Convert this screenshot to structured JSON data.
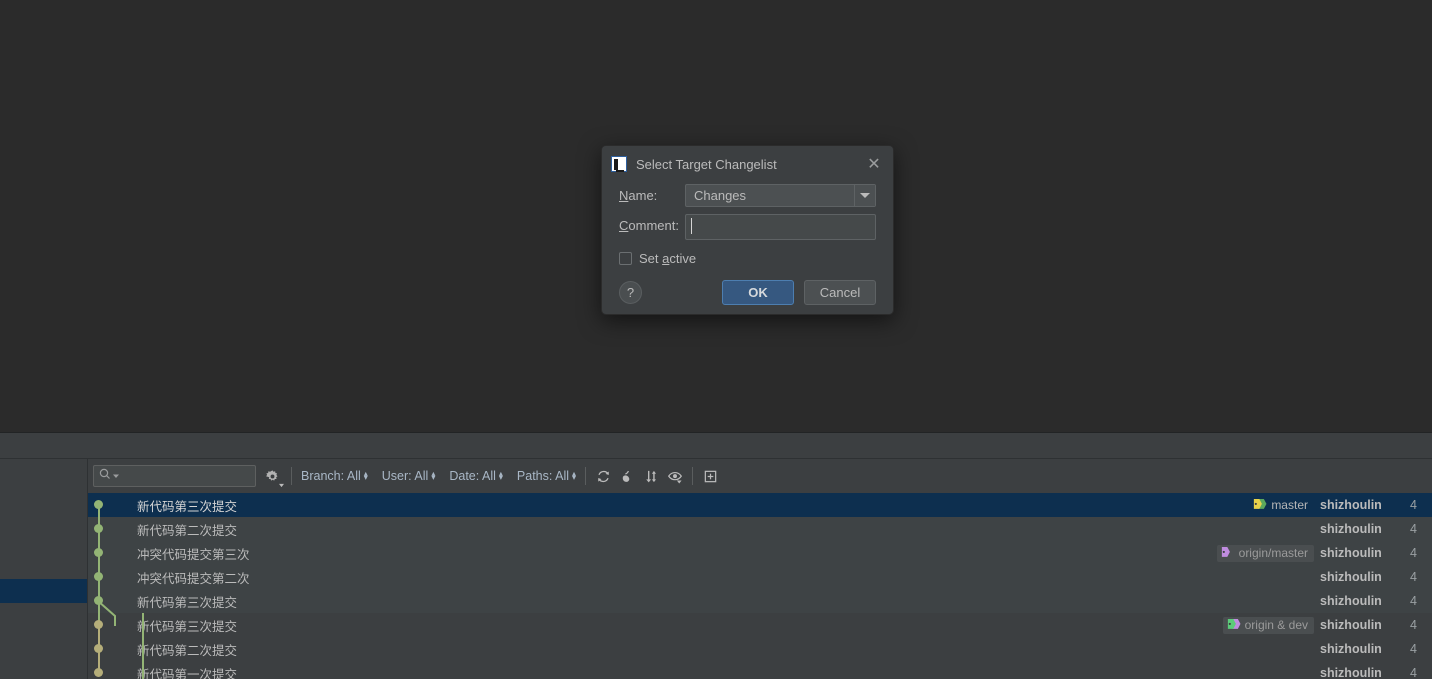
{
  "window": {
    "background": "#2b2b2b",
    "panel_background": "#3c3f41"
  },
  "dialog": {
    "title": "Select Target Changelist",
    "app_icon": "intellij-idea-logo-icon",
    "close_icon": "✕",
    "name_label": "Name:",
    "name_label_mnemonic": "N",
    "name_value": "Changes",
    "name_dropdown_icon": "chevron-down-icon",
    "comment_label": "Comment:",
    "comment_label_mnemonic": "C",
    "comment_value": "",
    "comment_placeholder": "",
    "set_active_label_pre": "Set ",
    "set_active_mnemonic": "a",
    "set_active_label_post": "ctive",
    "set_active_checked": false,
    "help_label": "?",
    "ok_label": "OK",
    "cancel_label": "Cancel",
    "ok_color": "#365880"
  },
  "log_toolbar": {
    "search_placeholder": "",
    "search_value": "",
    "search_icon": "search-icon",
    "search_dropdown_icon": "chevron-down-icon",
    "settings_icon": "gear-icon",
    "filters": [
      {
        "label": "Branch: All",
        "name": "branch-filter"
      },
      {
        "label": "User: All",
        "name": "user-filter"
      },
      {
        "label": "Date: All",
        "name": "date-filter"
      },
      {
        "label": "Paths: All",
        "name": "paths-filter"
      }
    ],
    "actions": [
      {
        "icon": "refresh-icon",
        "name": "refresh-button"
      },
      {
        "icon": "cherry-pick-icon",
        "name": "cherry-pick-button"
      },
      {
        "icon": "sort-icon",
        "name": "intellisort-button"
      },
      {
        "icon": "eye-icon",
        "name": "show-details-button"
      },
      {
        "icon": "open-in-new-tab-icon",
        "name": "open-new-tab-button"
      }
    ]
  },
  "commits": [
    {
      "subject": "新代码第三次提交",
      "author": "shizhoulin",
      "date": "4",
      "selected": true,
      "stripe": false,
      "node_color": "#93b475",
      "refs": [
        {
          "label": "master",
          "chip": false,
          "tag_colors": [
            "#e8d24a",
            "#5ca85c"
          ]
        }
      ]
    },
    {
      "subject": "新代码第二次提交",
      "author": "shizhoulin",
      "date": "4",
      "selected": false,
      "stripe": true,
      "node_color": "#93b475",
      "refs": []
    },
    {
      "subject": "冲突代码提交第三次",
      "author": "shizhoulin",
      "date": "4",
      "selected": false,
      "stripe": true,
      "node_color": "#93b475",
      "refs": [
        {
          "label": "origin/master",
          "chip": true,
          "tag_colors": [
            "#c08ce0"
          ]
        }
      ]
    },
    {
      "subject": "冲突代码提交第二次",
      "author": "shizhoulin",
      "date": "4",
      "selected": false,
      "stripe": true,
      "node_color": "#93b475",
      "refs": []
    },
    {
      "subject": "新代码第三次提交",
      "author": "shizhoulin",
      "date": "4",
      "selected": false,
      "stripe": true,
      "node_color": "#93b475",
      "refs": []
    },
    {
      "subject": "新代码第三次提交",
      "author": "shizhoulin",
      "date": "4",
      "selected": false,
      "stripe": false,
      "node_color": "#b5ae7a",
      "refs": [
        {
          "label": "origin & dev",
          "chip": true,
          "tag_colors": [
            "#5ccc7a",
            "#c08ce0"
          ]
        }
      ]
    },
    {
      "subject": "新代码第二次提交",
      "author": "shizhoulin",
      "date": "4",
      "selected": false,
      "stripe": false,
      "node_color": "#b5ae7a",
      "refs": []
    },
    {
      "subject": "新代码第一次提交",
      "author": "shizhoulin",
      "date": "4",
      "selected": false,
      "stripe": false,
      "node_color": "#b5ae7a",
      "refs": []
    }
  ],
  "left_panel": {
    "rows": [
      {
        "selected": false,
        "stripe": false
      },
      {
        "selected": false,
        "stripe": false
      },
      {
        "selected": false,
        "stripe": false
      },
      {
        "selected": false,
        "stripe": false
      },
      {
        "selected": false,
        "stripe": false
      },
      {
        "selected": true,
        "stripe": false
      },
      {
        "selected": false,
        "stripe": false
      },
      {
        "selected": false,
        "stripe": false
      },
      {
        "selected": false,
        "stripe": false
      }
    ]
  }
}
